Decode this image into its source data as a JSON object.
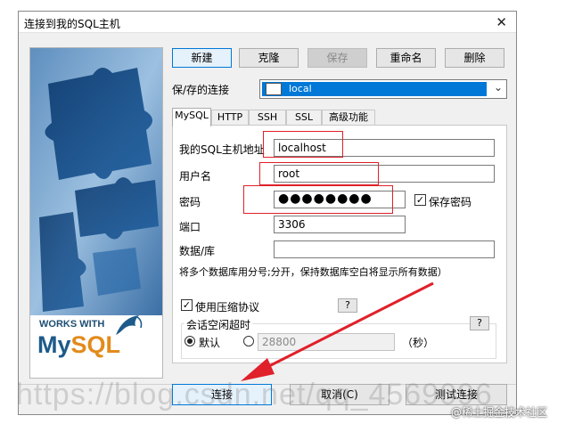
{
  "window": {
    "title": "连接到我的SQL主机",
    "close_glyph": "✕"
  },
  "toolbar": {
    "new_label": "新建",
    "clone_label": "克隆",
    "save_label": "保存",
    "rename_label": "重命名",
    "delete_label": "删除"
  },
  "saved_connection": {
    "label": "保/存的连接",
    "value": "local"
  },
  "tabs": [
    {
      "label": "MySQL",
      "active": true
    },
    {
      "label": "HTTP",
      "active": false
    },
    {
      "label": "SSH",
      "active": false
    },
    {
      "label": "SSL",
      "active": false
    },
    {
      "label": "高级功能",
      "active": false
    }
  ],
  "form": {
    "host_label": "我的SQL主机地址",
    "host_value": "localhost",
    "user_label": "用户名",
    "user_value": "root",
    "password_label": "密码",
    "password_value": "●●●●●●●●",
    "save_password_label": "保存密码",
    "port_label": "端口",
    "port_value": "3306",
    "database_label": "数据/库",
    "database_value": "",
    "database_hint": "将多个数据库用分号;分开，保持数据库空白将显示所有数据）",
    "compression_label": "使用压缩协议",
    "timeout_group_label": "会话空闲超时",
    "default_label": "默认",
    "timeout_value": "28800",
    "seconds_label": "（秒）",
    "help_label": "?"
  },
  "branding": {
    "works_with": "WORKS WITH",
    "logo_my": "My",
    "logo_sql": "SQL"
  },
  "footer": {
    "connect_label": "连接",
    "cancel_label": "取消(C)",
    "test_label": "测试连接"
  },
  "watermarks": {
    "url": "https://blog.csdn.net/qq_4569096",
    "site": "@稀土掘金技术社区"
  },
  "colors": {
    "accent": "#0078d7",
    "highlight": "#e0202a"
  }
}
